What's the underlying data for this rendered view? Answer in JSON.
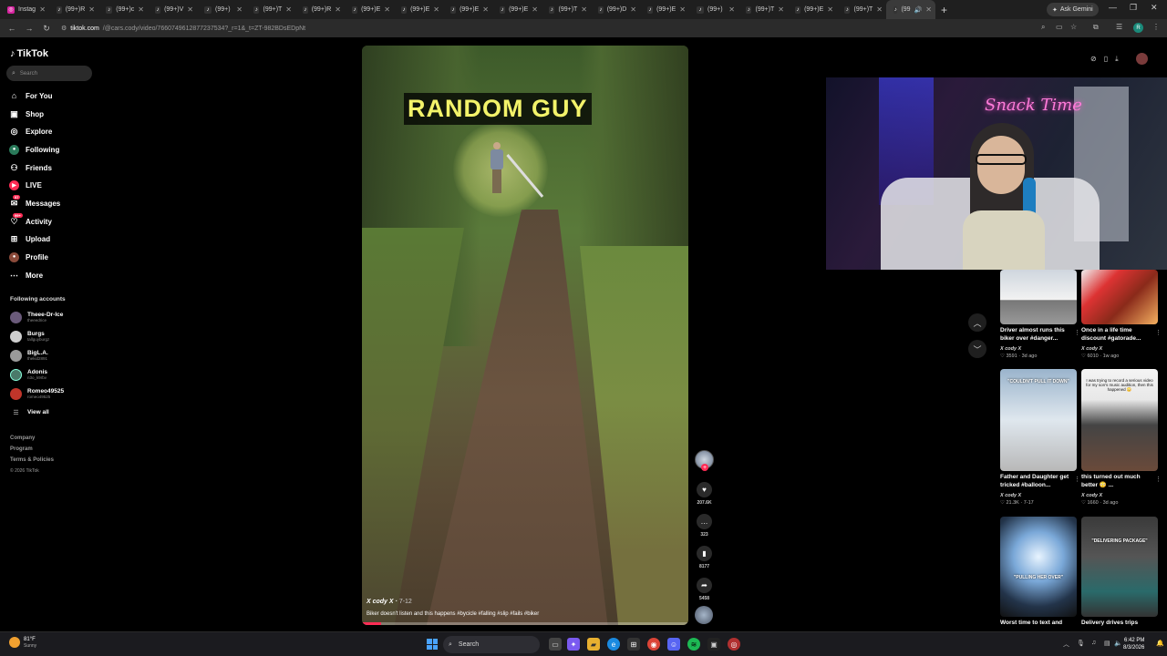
{
  "browser": {
    "tabs": [
      {
        "label": "Instag",
        "icon": "instagram-icon"
      },
      {
        "label": "(99+)R",
        "icon": "tiktok-icon"
      },
      {
        "label": "(99+)c",
        "icon": "tiktok-icon"
      },
      {
        "label": "(99+)V",
        "icon": "tiktok-icon"
      },
      {
        "label": "(99+)",
        "icon": "tiktok-icon"
      },
      {
        "label": "(99+)T",
        "icon": "tiktok-icon"
      },
      {
        "label": "(99+)R",
        "icon": "tiktok-icon"
      },
      {
        "label": "(99+)E",
        "icon": "tiktok-icon"
      },
      {
        "label": "(99+)E",
        "icon": "tiktok-icon"
      },
      {
        "label": "(99+)E",
        "icon": "tiktok-icon"
      },
      {
        "label": "(99+)E",
        "icon": "tiktok-icon"
      },
      {
        "label": "(99+)T",
        "icon": "tiktok-icon"
      },
      {
        "label": "(99+)D",
        "icon": "tiktok-icon"
      },
      {
        "label": "(99+)E",
        "icon": "tiktok-icon"
      },
      {
        "label": "(99+)",
        "icon": "tiktok-icon"
      },
      {
        "label": "(99+)T",
        "icon": "tiktok-icon"
      },
      {
        "label": "(99+)E",
        "icon": "tiktok-icon"
      },
      {
        "label": "(99+)T",
        "icon": "tiktok-icon"
      },
      {
        "label": "(99",
        "icon": "tiktok-icon"
      }
    ],
    "gemini_label": "Ask Gemini",
    "url_host": "tiktok.com",
    "url_path": "/@cars.cody/video/7660749612877237534?_r=1&_t=ZT-982BDsEDpNt",
    "profile_initial": "R"
  },
  "sidebar": {
    "logo": "TikTok",
    "search_placeholder": "Search",
    "nav": [
      {
        "label": "For You",
        "icon": "home-icon"
      },
      {
        "label": "Shop",
        "icon": "shop-icon"
      },
      {
        "label": "Explore",
        "icon": "compass-icon"
      },
      {
        "label": "Following",
        "icon": "following-icon"
      },
      {
        "label": "Friends",
        "icon": "friends-icon"
      },
      {
        "label": "LIVE",
        "icon": "live-icon"
      },
      {
        "label": "Messages",
        "icon": "messages-icon",
        "badge": "57"
      },
      {
        "label": "Activity",
        "icon": "activity-icon",
        "badge": "99+"
      },
      {
        "label": "Upload",
        "icon": "upload-icon"
      },
      {
        "label": "Profile",
        "icon": "profile-icon"
      },
      {
        "label": "More",
        "icon": "more-icon"
      }
    ],
    "following_heading": "Following accounts",
    "following": [
      {
        "name": "Theee-Dr-Ice",
        "handle": "theeedrice"
      },
      {
        "name": "Burgs",
        "handle": "tallguyburgz"
      },
      {
        "name": "BigL.A.",
        "handle": "thekid2891"
      },
      {
        "name": "Adonis",
        "handle": "n3o_k9rbv"
      },
      {
        "name": "Romeo49525",
        "handle": "romeo49525"
      }
    ],
    "view_all": "View all",
    "footer": [
      "Company",
      "Program",
      "Terms & Policies"
    ],
    "copyright": "© 2026 TikTok"
  },
  "video": {
    "caption_overlay": "RANDOM GUY",
    "author": "X cody X",
    "date": "7-12",
    "description": "Biker doesn't listen and this happens #bycicle #falling #slip #fails #biker",
    "progress": 0.06
  },
  "actions": {
    "likes": "207.6K",
    "comments": "323",
    "saves": "8177",
    "shares": "5458"
  },
  "stream_overlay": {
    "neon_sign": "Snack Time"
  },
  "recommended": [
    {
      "title": "Driver almost runs this biker over #danger...",
      "author": "X cody X",
      "meta": "3591 · 3d ago",
      "thumb_text": ""
    },
    {
      "title": "Once in a life time discount #gatorade...",
      "author": "X cody X",
      "meta": "6010 · 1w ago",
      "thumb_text": ""
    },
    {
      "title": "Father and Daughter get tricked #balloon...",
      "author": "X cody X",
      "meta": "21.3K · 7-17",
      "thumb_text": "\"COULDN'T PULL IT DOWN\""
    },
    {
      "title": "this turned out much better 😳 ...",
      "author": "X cody X",
      "meta": "1660 · 3d ago",
      "thumb_text": "I was trying to record a serious video for my son's music audition, then this happened 😳"
    },
    {
      "title": "Worst time to text and",
      "author": "",
      "meta": "",
      "thumb_text": "\"PULLING HER OVER\""
    },
    {
      "title": "Delivery drives trips",
      "author": "",
      "meta": "",
      "thumb_text": "\"DELIVERING PACKAGE\""
    }
  ],
  "taskbar": {
    "temp": "81°F",
    "condition": "Sunny",
    "search_label": "Search",
    "time": "6:42 PM",
    "date": "8/3/2026"
  },
  "colors": {
    "accent": "#fe2c55",
    "caption_yellow": "#f3f36a"
  }
}
